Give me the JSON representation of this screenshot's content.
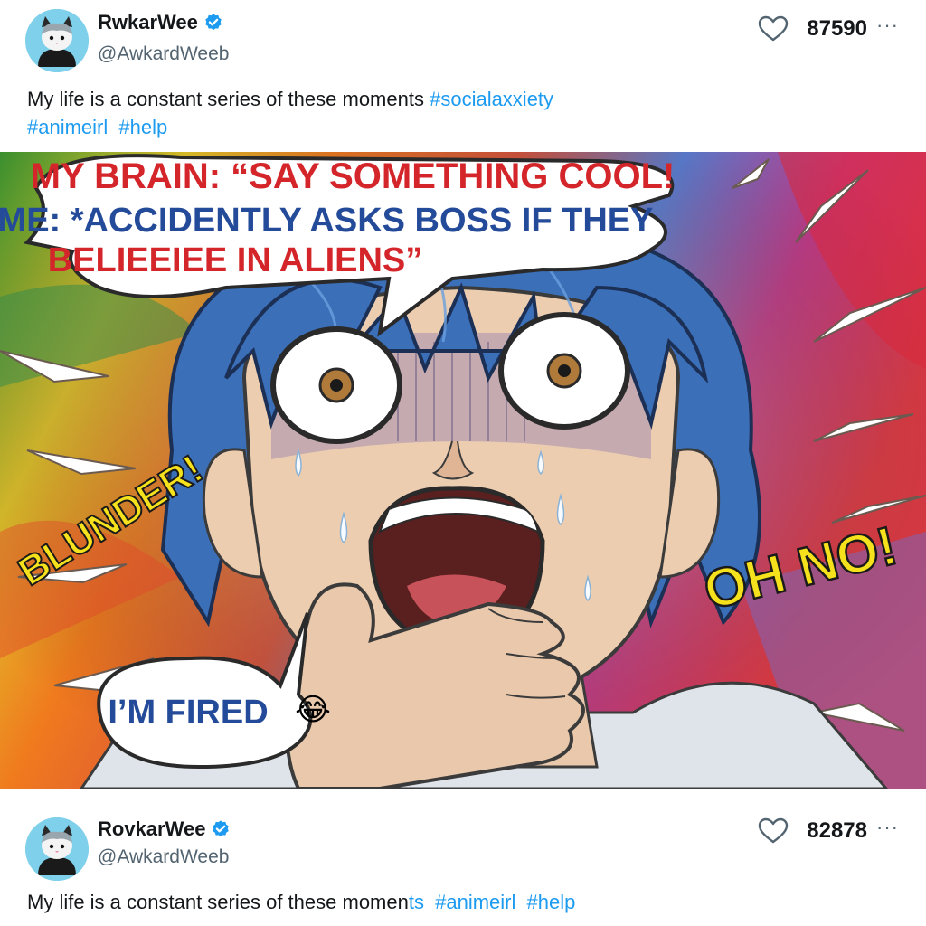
{
  "post_top": {
    "display_name": "RwkarWee",
    "handle": "@AwkardWeeb",
    "likes": "87590",
    "text": "My life is a constant series of these moments",
    "hashtags": [
      "#socialaxxiety",
      "#animeirl",
      "#help"
    ],
    "avatar_icon": "cat-icon",
    "verified_icon": "verified-badge-icon",
    "like_icon": "heart-icon",
    "menu_icon": "more-icon"
  },
  "image": {
    "speech_line1": "MY BRAIN: “SAY SOMETHING COOL!",
    "speech_line2": "ME: *ACCIDENTLY ASKS BOSS IF THEY",
    "speech_line3": "BELIEEIEE IN ALIENS”",
    "left_shout": "BLUNDER!",
    "right_shout": "OH NO!",
    "bubble_text": "I’M FIRED",
    "bubble_emoji": "😂"
  },
  "post_bottom": {
    "display_name": "RovkarWee",
    "handle": "@AwkardWeeb",
    "likes": "82878",
    "text_main": "My life is a constant series of these momen",
    "text_blue": "ts",
    "hashtags": [
      "#animeirl",
      "#help"
    ]
  },
  "colors": {
    "verified": "#1d9bf0",
    "link": "#1d9bf0",
    "hair": "#3b6fb8",
    "speech_red": "#d4262a",
    "speech_blue": "#244a9a",
    "shout_yellow": "#f5e21c"
  }
}
